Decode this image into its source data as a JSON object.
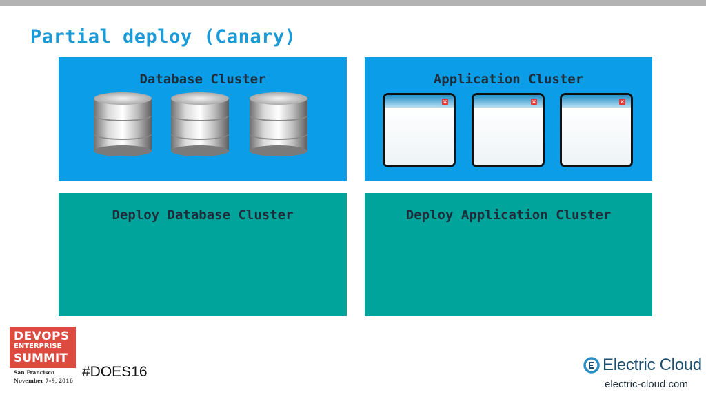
{
  "slide": {
    "title": "Partial deploy (Canary)"
  },
  "panels": {
    "database_cluster": {
      "label": "Database Cluster",
      "nodes": [
        "database-1",
        "database-2",
        "database-3"
      ]
    },
    "application_cluster": {
      "label": "Application Cluster",
      "nodes": [
        "window-1",
        "window-2",
        "window-3"
      ]
    },
    "deploy_database": {
      "label": "Deploy Database Cluster"
    },
    "deploy_application": {
      "label": "Deploy Application Cluster"
    }
  },
  "footer": {
    "event_logo": {
      "line1": "DEVOPS",
      "line2": "ENTERPRISE",
      "line3": "SUMMIT",
      "line4": "San Francisco",
      "line5": "November 7–9, 2016"
    },
    "hashtag": "#DOES16",
    "company": "Electric Cloud",
    "url": "electric-cloud.com"
  },
  "colors": {
    "title": "#1a9ad6",
    "panel_blue": "#0b9de8",
    "panel_teal": "#00a49a",
    "logo_red": "#dd4a3f"
  },
  "icons": [
    "database-icon",
    "app-window-icon",
    "close-icon",
    "electric-cloud-logo-icon"
  ]
}
